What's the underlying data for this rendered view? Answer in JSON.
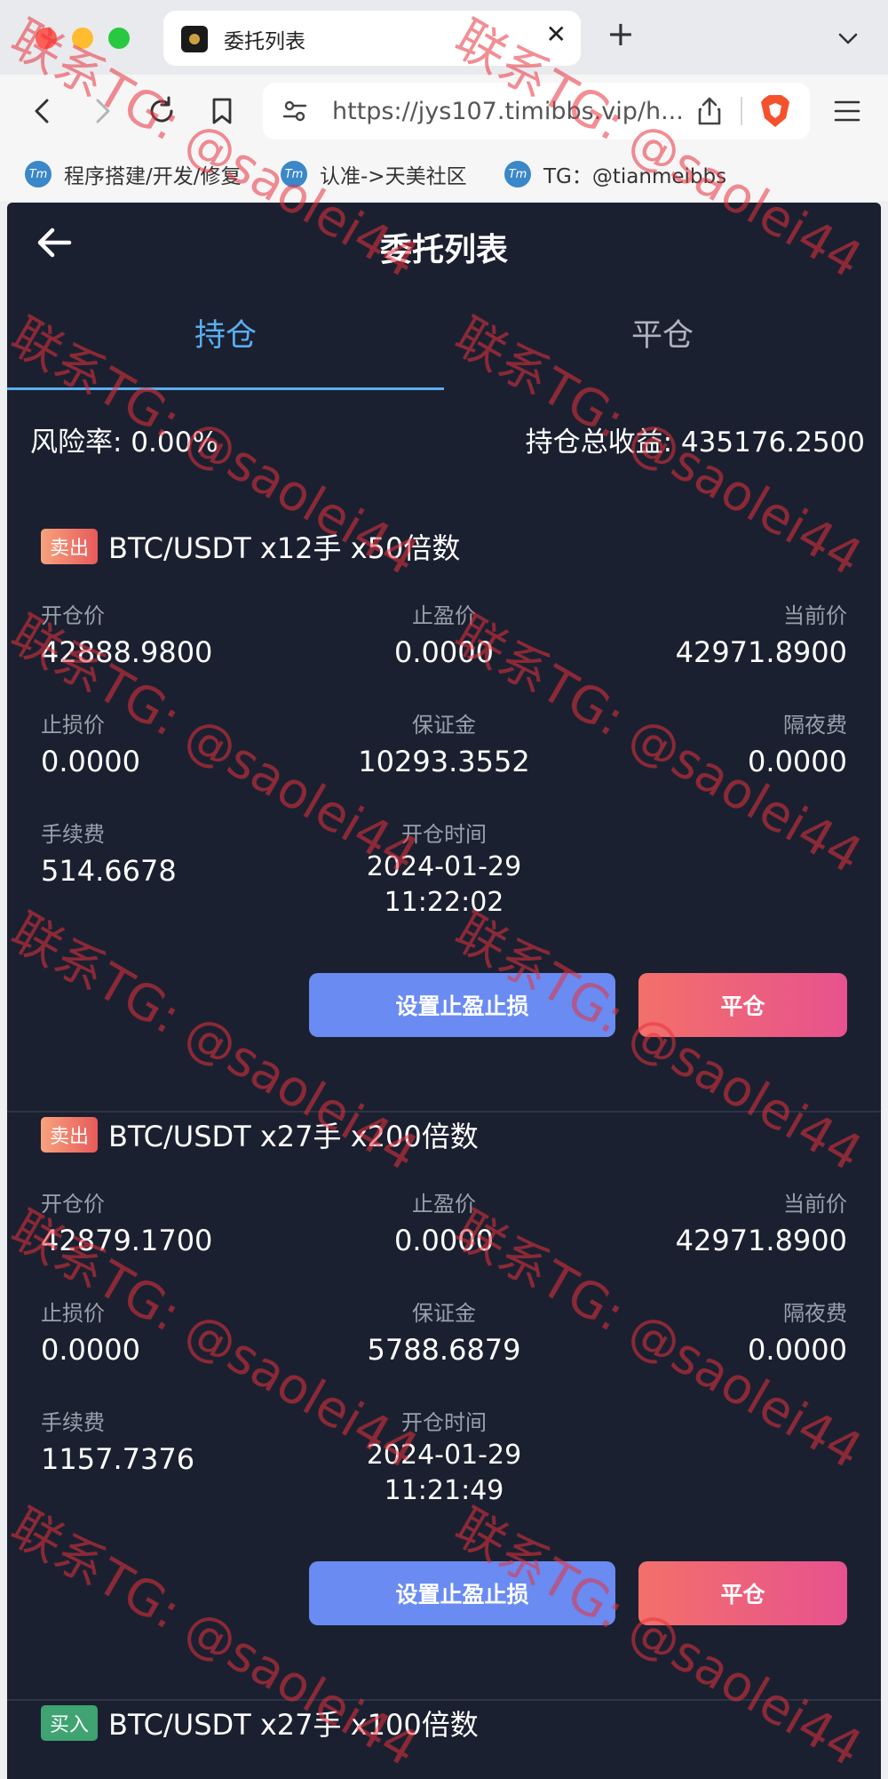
{
  "browser": {
    "tab_title": "委托列表",
    "tab_close": "✕",
    "new_tab": "+",
    "url": "https://jys107.timibbs.vip/h...",
    "bookmarks": [
      {
        "icon": "Tm",
        "label": "程序搭建/开发/修复"
      },
      {
        "icon": "Tm",
        "label": "认准->天美社区"
      },
      {
        "icon": "Tm",
        "label": "TG：@tianmeibbs"
      }
    ]
  },
  "app": {
    "title": "委托列表",
    "tabs": [
      {
        "label": "持仓",
        "active": true
      },
      {
        "label": "平仓",
        "active": false
      }
    ],
    "risk_label": "风险率: 0.00%",
    "pnl_label": "持仓总收益: 435176.2500",
    "field_labels": {
      "open_price": "开仓价",
      "take_profit": "止盈价",
      "current_price": "当前价",
      "stop_loss": "止损价",
      "margin": "保证金",
      "overnight_fee": "隔夜费",
      "fee": "手续费",
      "open_time": "开仓时间"
    },
    "buttons": {
      "tpsl": "设置止盈止损",
      "close": "平仓"
    },
    "orders": [
      {
        "side": "卖出",
        "symbol": "BTC/USDT x12手 x50倍数",
        "open_price": "42888.9800",
        "take_profit": "0.0000",
        "current_price": "42971.8900",
        "stop_loss": "0.0000",
        "margin": "10293.3552",
        "overnight_fee": "0.0000",
        "fee": "514.6678",
        "open_date": "2024-01-29",
        "open_clock": "11:22:02"
      },
      {
        "side": "卖出",
        "symbol": "BTC/USDT x27手 x200倍数",
        "open_price": "42879.1700",
        "take_profit": "0.0000",
        "current_price": "42971.8900",
        "stop_loss": "0.0000",
        "margin": "5788.6879",
        "overnight_fee": "0.0000",
        "fee": "1157.7376",
        "open_date": "2024-01-29",
        "open_clock": "11:21:49"
      },
      {
        "side": "买入",
        "symbol": "BTC/USDT x27手 x100倍数"
      }
    ]
  },
  "watermark": {
    "text": "联系TG: @saolei44"
  },
  "colors": {
    "app_bg": "#1b2030",
    "accent": "#5aaef0",
    "sell_badge": "#e75a5a",
    "buy_badge": "#3fa372",
    "tpsl_button": "#6a8bf1",
    "close_button": "#e7528e",
    "watermark": "#e8323c"
  }
}
